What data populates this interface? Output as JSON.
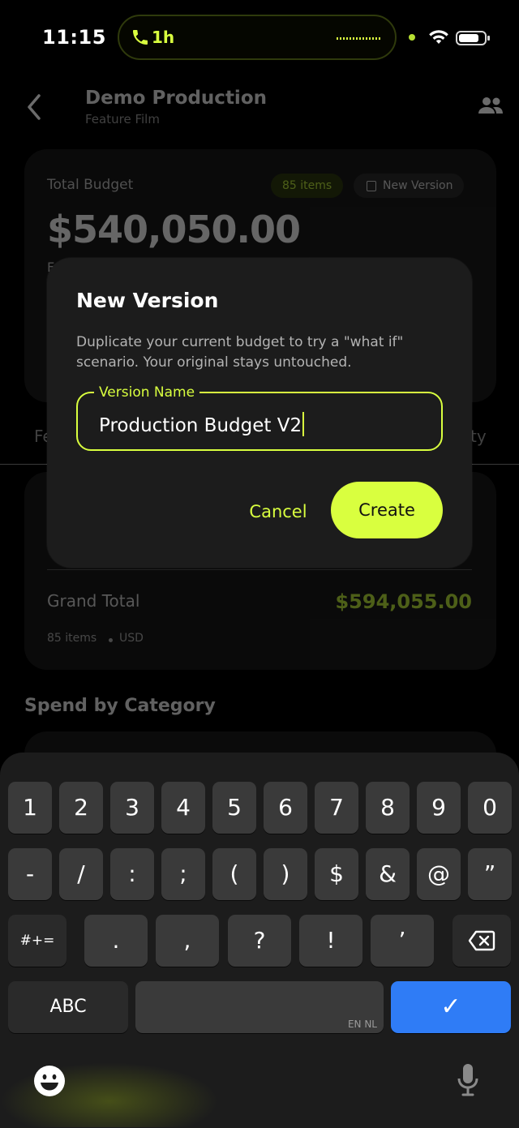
{
  "status_bar": {
    "time": "11:15",
    "call_duration": "1h"
  },
  "header": {
    "title": "Demo Production",
    "subtitle": "Feature Film"
  },
  "budget_card": {
    "label": "Total Budget",
    "items_badge": "85 items",
    "new_version_chip": "New Version",
    "amount": "$540,050.00",
    "peek_letter": "F"
  },
  "tabs_peek": {
    "left": "Fe",
    "right": "ty"
  },
  "summary": {
    "grand_total_label": "Grand Total",
    "grand_total_value": "$594,055.00",
    "item_count": "85 items",
    "currency": "USD"
  },
  "spend_heading": "Spend by Category",
  "dialog": {
    "title": "New Version",
    "description": "Duplicate your current budget to try a \"what if\" scenario. Your original stays untouched.",
    "field_label": "Version Name",
    "field_value": "Production Budget V2",
    "cancel_label": "Cancel",
    "create_label": "Create"
  },
  "keyboard": {
    "row1": [
      "1",
      "2",
      "3",
      "4",
      "5",
      "6",
      "7",
      "8",
      "9",
      "0"
    ],
    "row2": [
      "-",
      "/",
      ":",
      ";",
      "(",
      ")",
      "$",
      "&",
      "@",
      "”"
    ],
    "row3": [
      ".",
      ",",
      "?",
      "!",
      "’"
    ],
    "symbols_key": "#+=",
    "abc_key": "ABC",
    "space_hint": "EN NL",
    "return_glyph": "✓"
  },
  "colors": {
    "accent": "#d9ff3f",
    "background": "#000000",
    "card": "#1a1a1a",
    "return_key": "#2f7cf6"
  }
}
